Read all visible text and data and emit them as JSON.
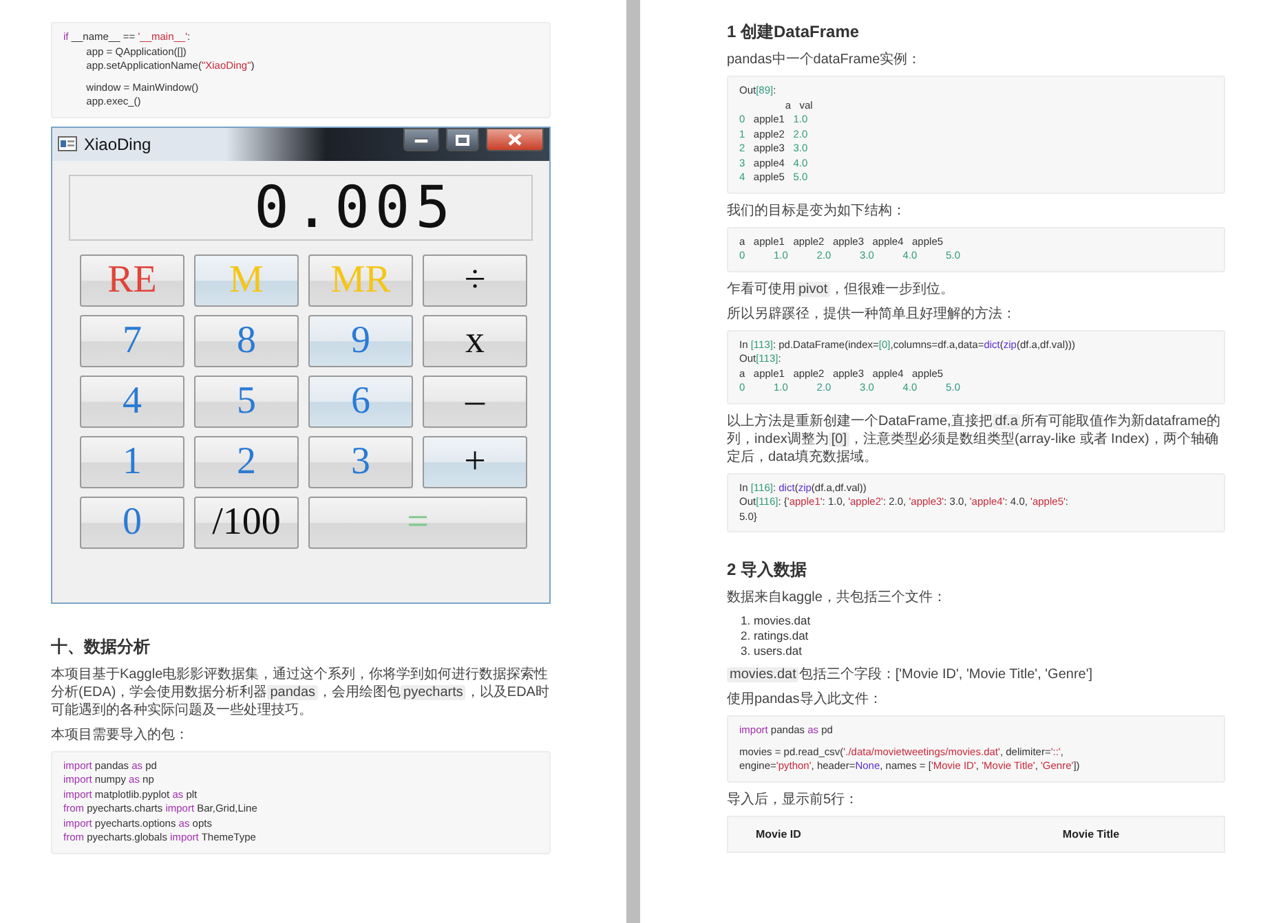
{
  "pages": [
    {
      "blocks": [
        {
          "kind": "code",
          "groups": [
            [
              [
                {
                  "kind": "kw",
                  "text": "if"
                },
                {
                  "kind": "p",
                  "text": " __name__ == "
                },
                {
                  "kind": "str",
                  "text": "'__main__'"
                },
                {
                  "kind": "p",
                  "text": ":"
                }
              ],
              [
                {
                  "kind": "p",
                  "text": "        app = QApplication([])"
                }
              ],
              [
                {
                  "kind": "p",
                  "text": "        app.setApplicationName("
                },
                {
                  "kind": "str",
                  "text": "\"XiaoDing\""
                },
                {
                  "kind": "p",
                  "text": ")"
                }
              ]
            ],
            [
              [
                {
                  "kind": "p",
                  "text": "        window = MainWindow()"
                }
              ],
              [
                {
                  "kind": "p",
                  "text": "        app.exec_()"
                }
              ]
            ]
          ]
        },
        {
          "kind": "calculator",
          "title": "XiaoDing",
          "display": "0.005",
          "buttons": [
            {
              "label": "RE",
              "color": "#e0443a",
              "highlighted": false,
              "wide": false
            },
            {
              "label": "M",
              "color": "#f5c518",
              "highlighted": true,
              "wide": false
            },
            {
              "label": "MR",
              "color": "#f5c518",
              "highlighted": false,
              "wide": false
            },
            {
              "label": "÷",
              "color": "#111111",
              "highlighted": false,
              "wide": false
            },
            {
              "label": "7",
              "color": "#2a7bd4",
              "highlighted": false,
              "wide": false
            },
            {
              "label": "8",
              "color": "#2a7bd4",
              "highlighted": false,
              "wide": false
            },
            {
              "label": "9",
              "color": "#2a7bd4",
              "highlighted": true,
              "wide": false
            },
            {
              "label": "x",
              "color": "#111111",
              "highlighted": false,
              "wide": false
            },
            {
              "label": "4",
              "color": "#2a7bd4",
              "highlighted": false,
              "wide": false
            },
            {
              "label": "5",
              "color": "#2a7bd4",
              "highlighted": false,
              "wide": false
            },
            {
              "label": "6",
              "color": "#2a7bd4",
              "highlighted": true,
              "wide": false
            },
            {
              "label": "–",
              "color": "#111111",
              "highlighted": false,
              "wide": false
            },
            {
              "label": "1",
              "color": "#2a7bd4",
              "highlighted": false,
              "wide": false
            },
            {
              "label": "2",
              "color": "#2a7bd4",
              "highlighted": false,
              "wide": false
            },
            {
              "label": "3",
              "color": "#2a7bd4",
              "highlighted": false,
              "wide": false
            },
            {
              "label": "+",
              "color": "#111111",
              "highlighted": true,
              "wide": false
            },
            {
              "label": "0",
              "color": "#2a7bd4",
              "highlighted": false,
              "wide": false
            },
            {
              "label": "/100",
              "color": "#111111",
              "highlighted": false,
              "wide": false
            },
            {
              "label": "=",
              "color": "#7cc98a",
              "highlighted": false,
              "wide": true
            }
          ]
        },
        {
          "kind": "heading",
          "text": "十、数据分析"
        },
        {
          "kind": "para",
          "parts": [
            {
              "text": "本项目基于Kaggle电影影评数据集，通过这个系列，你将学到如何进行数据探索性分析(EDA)，学会使用数据分析利器",
              "code": false
            },
            {
              "text": "pandas",
              "code": true
            },
            {
              "text": "，会用绘图包",
              "code": false
            },
            {
              "text": "pyecharts",
              "code": true
            },
            {
              "text": "，以及EDA时可能遇到的各种实际问题及一些处理技巧。",
              "code": false
            }
          ]
        },
        {
          "kind": "para",
          "parts": [
            {
              "text": "本项目需要导入的包：",
              "code": false
            }
          ]
        },
        {
          "kind": "code",
          "groups": [
            [
              [
                {
                  "kind": "kw",
                  "text": "import"
                },
                {
                  "kind": "p",
                  "text": " pandas "
                },
                {
                  "kind": "kw",
                  "text": "as"
                },
                {
                  "kind": "p",
                  "text": " pd"
                }
              ],
              [
                {
                  "kind": "kw",
                  "text": "import"
                },
                {
                  "kind": "p",
                  "text": " numpy "
                },
                {
                  "kind": "kw",
                  "text": "as"
                },
                {
                  "kind": "p",
                  "text": " np"
                }
              ],
              [
                {
                  "kind": "kw",
                  "text": "import"
                },
                {
                  "kind": "p",
                  "text": " matplotlib.pyplot "
                },
                {
                  "kind": "kw",
                  "text": "as"
                },
                {
                  "kind": "p",
                  "text": " plt"
                }
              ],
              [
                {
                  "kind": "kw",
                  "text": "from"
                },
                {
                  "kind": "p",
                  "text": " pyecharts.charts "
                },
                {
                  "kind": "kw",
                  "text": "import"
                },
                {
                  "kind": "p",
                  "text": " Bar,Grid,Line"
                }
              ],
              [
                {
                  "kind": "kw",
                  "text": "import"
                },
                {
                  "kind": "p",
                  "text": " pyecharts.options "
                },
                {
                  "kind": "kw",
                  "text": "as"
                },
                {
                  "kind": "p",
                  "text": " opts"
                }
              ],
              [
                {
                  "kind": "kw",
                  "text": "from"
                },
                {
                  "kind": "p",
                  "text": " pyecharts.globals "
                },
                {
                  "kind": "kw",
                  "text": "import"
                },
                {
                  "kind": "p",
                  "text": " ThemeType"
                }
              ]
            ]
          ]
        }
      ]
    },
    {
      "blocks": [
        {
          "kind": "heading",
          "text": "1 创建DataFrame"
        },
        {
          "kind": "para",
          "parts": [
            {
              "text": "pandas中一个dataFrame实例：",
              "code": false
            }
          ]
        },
        {
          "kind": "code",
          "groups": [
            [
              [
                {
                  "kind": "p",
                  "text": "Out"
                },
                {
                  "kind": "num",
                  "text": "[89]"
                },
                {
                  "kind": "p",
                  "text": ":"
                }
              ],
              [
                {
                  "kind": "p",
                  "text": "                a   val"
                }
              ],
              [
                {
                  "kind": "num",
                  "text": "0"
                },
                {
                  "kind": "p",
                  "text": "   apple1   "
                },
                {
                  "kind": "num",
                  "text": "1.0"
                }
              ],
              [
                {
                  "kind": "num",
                  "text": "1"
                },
                {
                  "kind": "p",
                  "text": "   apple2   "
                },
                {
                  "kind": "num",
                  "text": "2.0"
                }
              ],
              [
                {
                  "kind": "num",
                  "text": "2"
                },
                {
                  "kind": "p",
                  "text": "   apple3   "
                },
                {
                  "kind": "num",
                  "text": "3.0"
                }
              ],
              [
                {
                  "kind": "num",
                  "text": "3"
                },
                {
                  "kind": "p",
                  "text": "   apple4   "
                },
                {
                  "kind": "num",
                  "text": "4.0"
                }
              ],
              [
                {
                  "kind": "num",
                  "text": "4"
                },
                {
                  "kind": "p",
                  "text": "   apple5   "
                },
                {
                  "kind": "num",
                  "text": "5.0"
                }
              ]
            ]
          ]
        },
        {
          "kind": "para",
          "parts": [
            {
              "text": "我们的目标是变为如下结构：",
              "code": false
            }
          ]
        },
        {
          "kind": "code",
          "groups": [
            [
              [
                {
                  "kind": "p",
                  "text": "a   apple1   apple2   apple3   apple4   apple5"
                }
              ],
              [
                {
                  "kind": "num",
                  "text": "0          1.0          2.0          3.0          4.0          5.0"
                }
              ]
            ]
          ]
        },
        {
          "kind": "para",
          "parts": [
            {
              "text": "乍看可使用",
              "code": false
            },
            {
              "text": "pivot",
              "code": true
            },
            {
              "text": "，但很难一步到位。",
              "code": false
            }
          ]
        },
        {
          "kind": "para",
          "parts": [
            {
              "text": "所以另辟蹊径，提供一种简单且好理解的方法：",
              "code": false
            }
          ]
        },
        {
          "kind": "code",
          "groups": [
            [
              [
                {
                  "kind": "p",
                  "text": "In "
                },
                {
                  "kind": "num",
                  "text": "[113]"
                },
                {
                  "kind": "p",
                  "text": ": pd.DataFrame(index="
                },
                {
                  "kind": "num",
                  "text": "[0]"
                },
                {
                  "kind": "p",
                  "text": ",columns=df.a,data="
                },
                {
                  "kind": "fn",
                  "text": "dict"
                },
                {
                  "kind": "p",
                  "text": "("
                },
                {
                  "kind": "fn",
                  "text": "zip"
                },
                {
                  "kind": "p",
                  "text": "(df.a,df.val)))"
                }
              ],
              [
                {
                  "kind": "p",
                  "text": "Out"
                },
                {
                  "kind": "num",
                  "text": "[113]"
                },
                {
                  "kind": "p",
                  "text": ":"
                }
              ],
              [
                {
                  "kind": "p",
                  "text": "a   apple1   apple2   apple3   apple4   apple5"
                }
              ],
              [
                {
                  "kind": "num",
                  "text": "0          1.0          2.0          3.0          4.0          5.0"
                }
              ]
            ]
          ]
        },
        {
          "kind": "para",
          "parts": [
            {
              "text": "以上方法是重新创建一个DataFrame,直接把",
              "code": false
            },
            {
              "text": "df.a",
              "code": true
            },
            {
              "text": "所有可能取值作为新dataframe的列，index调整为",
              "code": false
            },
            {
              "text": "[0]",
              "code": true
            },
            {
              "text": "，注意类型必须是数组类型(array-like 或者 Index)，两个轴确定后，data填充数据域。",
              "code": false
            }
          ]
        },
        {
          "kind": "code",
          "groups": [
            [
              [
                {
                  "kind": "p",
                  "text": "In "
                },
                {
                  "kind": "num",
                  "text": "[116]"
                },
                {
                  "kind": "p",
                  "text": ": "
                },
                {
                  "kind": "fn",
                  "text": "dict"
                },
                {
                  "kind": "p",
                  "text": "("
                },
                {
                  "kind": "fn",
                  "text": "zip"
                },
                {
                  "kind": "p",
                  "text": "(df.a,df.val))"
                }
              ],
              [
                {
                  "kind": "p",
                  "text": "Out"
                },
                {
                  "kind": "num",
                  "text": "[116]"
                },
                {
                  "kind": "p",
                  "text": ": {"
                },
                {
                  "kind": "str",
                  "text": "'apple1'"
                },
                {
                  "kind": "p",
                  "text": ": 1.0, "
                },
                {
                  "kind": "str",
                  "text": "'apple2'"
                },
                {
                  "kind": "p",
                  "text": ": 2.0, "
                },
                {
                  "kind": "str",
                  "text": "'apple3'"
                },
                {
                  "kind": "p",
                  "text": ": 3.0, "
                },
                {
                  "kind": "str",
                  "text": "'apple4'"
                },
                {
                  "kind": "p",
                  "text": ": 4.0, "
                },
                {
                  "kind": "str",
                  "text": "'apple5'"
                },
                {
                  "kind": "p",
                  "text": ":"
                }
              ],
              [
                {
                  "kind": "p",
                  "text": "5.0}"
                }
              ]
            ]
          ]
        },
        {
          "kind": "heading",
          "text": "2 导入数据"
        },
        {
          "kind": "para",
          "parts": [
            {
              "text": "数据来自kaggle，共包括三个文件：",
              "code": false
            }
          ]
        },
        {
          "kind": "list",
          "items": [
            {
              "marker": "1.",
              "text": "movies.dat"
            },
            {
              "marker": "2.",
              "text": "ratings.dat"
            },
            {
              "marker": "3.",
              "text": "users.dat"
            }
          ]
        },
        {
          "kind": "para",
          "parts": [
            {
              "text": "movies.dat",
              "code": true
            },
            {
              "text": "包括三个字段：['Movie ID', 'Movie Title', 'Genre']",
              "code": false
            }
          ]
        },
        {
          "kind": "para",
          "parts": [
            {
              "text": "使用pandas导入此文件：",
              "code": false
            }
          ]
        },
        {
          "kind": "code",
          "groups": [
            [
              [
                {
                  "kind": "kw",
                  "text": "import"
                },
                {
                  "kind": "p",
                  "text": " pandas "
                },
                {
                  "kind": "kw",
                  "text": "as"
                },
                {
                  "kind": "p",
                  "text": " pd"
                }
              ]
            ],
            [
              [
                {
                  "kind": "p",
                  "text": "movies = pd.read_csv("
                },
                {
                  "kind": "str",
                  "text": "'./data/movietweetings/movies.dat'"
                },
                {
                  "kind": "p",
                  "text": ", delimiter="
                },
                {
                  "kind": "str",
                  "text": "'::'"
                },
                {
                  "kind": "p",
                  "text": ","
                }
              ],
              [
                {
                  "kind": "p",
                  "text": "engine="
                },
                {
                  "kind": "str",
                  "text": "'python'"
                },
                {
                  "kind": "p",
                  "text": ", header="
                },
                {
                  "kind": "fn",
                  "text": "None"
                },
                {
                  "kind": "p",
                  "text": ", names = ["
                },
                {
                  "kind": "str",
                  "text": "'Movie ID'"
                },
                {
                  "kind": "p",
                  "text": ", "
                },
                {
                  "kind": "str",
                  "text": "'Movie Title'"
                },
                {
                  "kind": "p",
                  "text": ", "
                },
                {
                  "kind": "str",
                  "text": "'Genre'"
                },
                {
                  "kind": "p",
                  "text": "])"
                }
              ]
            ]
          ]
        },
        {
          "kind": "para",
          "parts": [
            {
              "text": "导入后，显示前5行：",
              "code": false
            }
          ]
        },
        {
          "kind": "table",
          "columns": [
            "Movie ID",
            "Movie Title"
          ]
        }
      ]
    }
  ]
}
